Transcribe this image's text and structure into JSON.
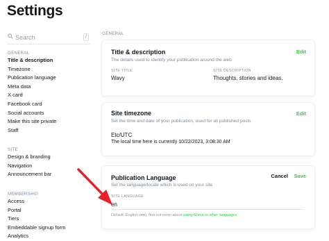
{
  "page": {
    "title": "Settings"
  },
  "search": {
    "placeholder": "Search",
    "shortcut": "/"
  },
  "sidebar": {
    "general": {
      "label": "GENERAL",
      "items": [
        "Title & description",
        "Timezone",
        "Publication language",
        "Meta data",
        "X card",
        "Facebook card",
        "Social accounts",
        "Make this site private",
        "Staff"
      ]
    },
    "site": {
      "label": "SITE",
      "items": [
        "Design & branding",
        "Navigation",
        "Announcement bar"
      ]
    },
    "membership": {
      "label": "MEMBERSHIP",
      "items": [
        "Access",
        "Portal",
        "Tiers",
        "Embeddable signup form",
        "Analytics"
      ]
    }
  },
  "main": {
    "group_label": "GENERAL",
    "title_card": {
      "title": "Title & description",
      "description": "The details used to identify your publication around the web",
      "edit": "Edit",
      "site_title_label": "SITE TITLE",
      "site_title": "Wavy",
      "site_desc_label": "SITE DESCRIPTION",
      "site_desc": "Thoughts, stories and ideas."
    },
    "timezone_card": {
      "title": "Site timezone",
      "description": "Set the time and date of your publication, used for all published posts",
      "edit": "Edit",
      "timezone": "Etc/UTC",
      "local_time": "The local time here is currently 10/22/2023, 3:08:30 AM"
    },
    "language_card": {
      "title": "Publication Language",
      "description": "Set the language/locale which is used on your site",
      "cancel": "Cancel",
      "save": "Save",
      "field_label": "SITE LANGUAGE",
      "value": "en",
      "hint_prefix": "Default: English (",
      "hint_code": "en",
      "hint_middle": "); find out more about ",
      "hint_link": "using Ghost in other languages"
    }
  },
  "colors": {
    "accent": "#30cf43",
    "annotation": "#e8202a",
    "muted": "#7c8b9a"
  }
}
